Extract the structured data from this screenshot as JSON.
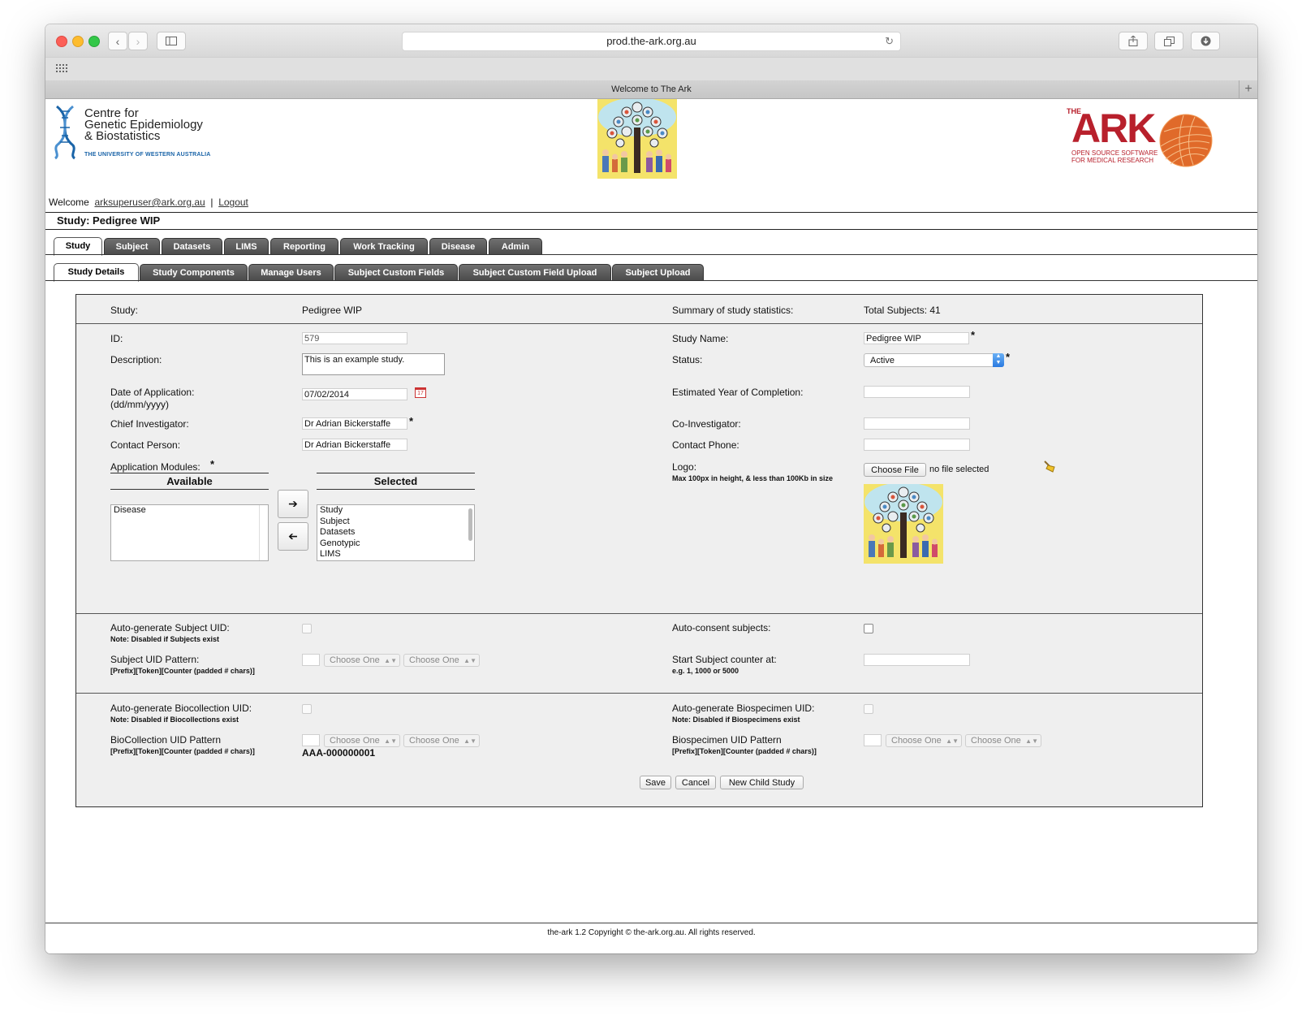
{
  "browser": {
    "url": "prod.the-ark.org.au",
    "tab_title": "Welcome to The Ark",
    "new_tab": "+"
  },
  "header": {
    "org_line1": "Centre for",
    "org_line2": "Genetic Epidemiology",
    "org_line3": "& Biostatistics",
    "org_sub": "THE UNIVERSITY OF WESTERN AUSTRALIA",
    "ark_the": "THE",
    "ark_title": "ARK",
    "ark_sub1": "OPEN SOURCE SOFTWARE",
    "ark_sub2": "FOR MEDICAL RESEARCH",
    "welcome": "Welcome",
    "user": "arksuperuser@ark.org.au",
    "separator": "|",
    "logout": "Logout",
    "study_heading": "Study: Pedigree WIP"
  },
  "main_tabs": [
    "Study",
    "Subject",
    "Datasets",
    "LIMS",
    "Reporting",
    "Work Tracking",
    "Disease",
    "Admin"
  ],
  "sub_tabs": [
    "Study Details",
    "Study Components",
    "Manage Users",
    "Subject Custom Fields",
    "Subject Custom Field Upload",
    "Subject Upload"
  ],
  "form": {
    "study_label": "Study:",
    "study_value": "Pedigree WIP",
    "summary_label": "Summary of study statistics:",
    "summary_value": "Total Subjects: 41",
    "id_label": "ID:",
    "id_value": "579",
    "description_label": "Description:",
    "description_value": "This is an example study.",
    "doa_label": "Date of Application:",
    "doa_label2": "(dd/mm/yyyy)",
    "doa_value": "07/02/2014",
    "calendar_day": "17",
    "chief_label": "Chief Investigator:",
    "chief_value": "Dr Adrian Bickerstaffe",
    "contact_label": "Contact Person:",
    "contact_value": "Dr Adrian Bickerstaffe",
    "modules_label": "Application Modules:",
    "required_mark": "*",
    "available_header": "Available",
    "selected_header": "Selected",
    "available_items": [
      "Disease"
    ],
    "selected_items": [
      "Study",
      "Subject",
      "Datasets",
      "Genotypic",
      "LIMS"
    ],
    "move_right": "➔",
    "move_left": "➔",
    "study_name_label": "Study Name:",
    "study_name_value": "Pedigree WIP",
    "status_label": "Status:",
    "status_value": "Active",
    "eyc_label": "Estimated Year of Completion:",
    "coinv_label": "Co-Investigator:",
    "phone_label": "Contact Phone:",
    "logo_label": "Logo:",
    "logo_note": "Max 100px in height, & less than 100Kb in size",
    "choose_file": "Choose File",
    "no_file": "no file selected",
    "autogen_subject_label": "Auto-generate Subject UID:",
    "autogen_subject_note": "Note: Disabled if Subjects exist",
    "subject_pattern_label": "Subject UID Pattern:",
    "pattern_note": "[Prefix][Token][Counter (padded # chars)]",
    "choose_one": "Choose One",
    "autoconsent_label": "Auto-consent subjects:",
    "start_counter_label": "Start Subject counter at:",
    "start_counter_note": "e.g. 1, 1000 or 5000",
    "autogen_bio_label": "Auto-generate Biocollection UID:",
    "autogen_bio_note": "Note: Disabled if Biocollections exist",
    "bio_pattern_label": "BioCollection UID Pattern",
    "bio_example": "AAA-000000001",
    "autogen_specimen_label": "Auto-generate Biospecimen UID:",
    "autogen_specimen_note": "Note: Disabled if Biospecimens exist",
    "specimen_pattern_label": "Biospecimen UID Pattern",
    "save": "Save",
    "cancel": "Cancel",
    "new_child": "New Child Study"
  },
  "footer": "the-ark 1.2 Copyright © the-ark.org.au. All rights reserved.",
  "colors": {
    "ark_red": "#b8202c",
    "ark_orange": "#e06a2a",
    "cgeb_blue": "#1a64a8",
    "tab_dark": "#555555",
    "form_bg": "#efefef"
  }
}
